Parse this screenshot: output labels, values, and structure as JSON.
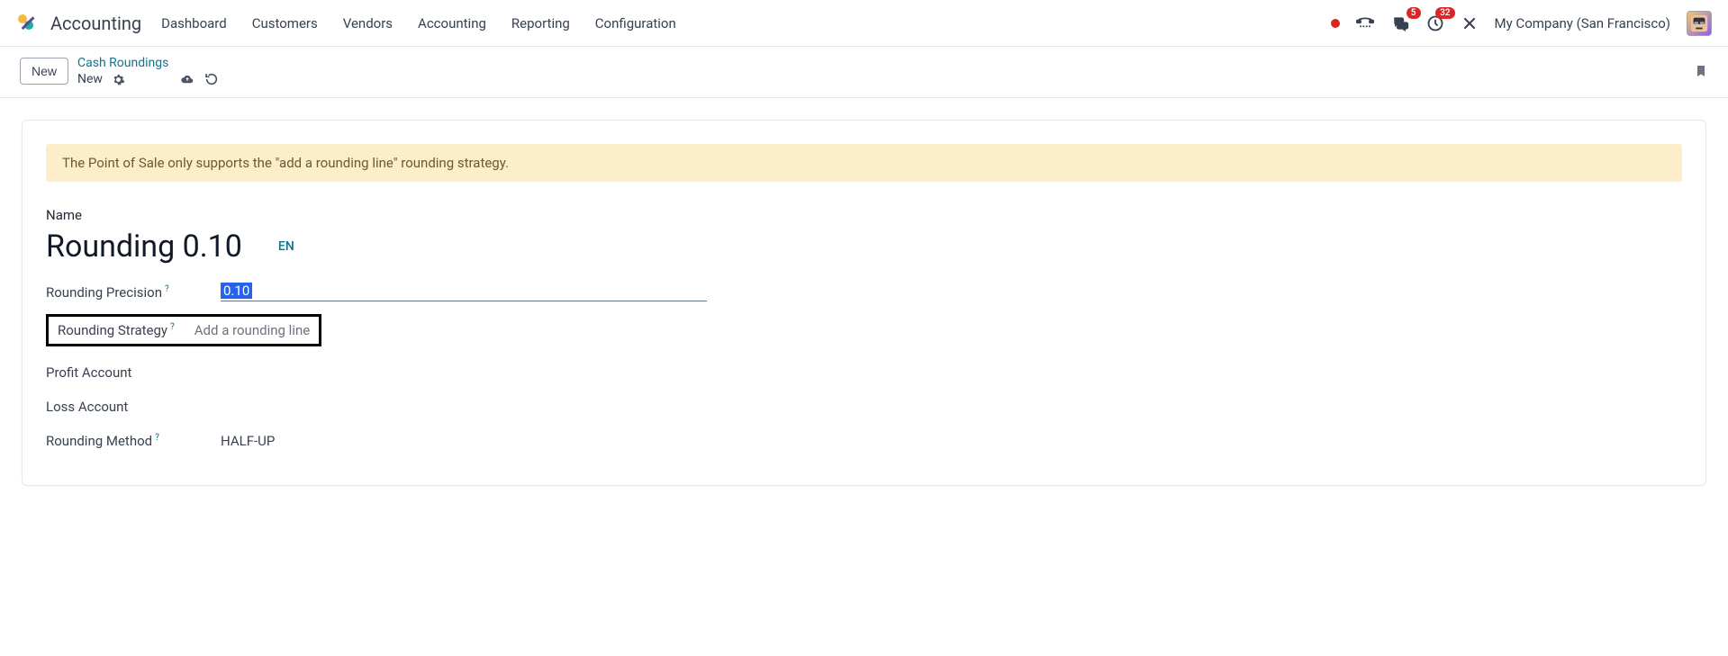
{
  "topbar": {
    "brand": "Accounting",
    "nav": [
      "Dashboard",
      "Customers",
      "Vendors",
      "Accounting",
      "Reporting",
      "Configuration"
    ],
    "badges": {
      "messages": "5",
      "activities": "32"
    },
    "company": "My Company (San Francisco)"
  },
  "subbar": {
    "new_btn": "New",
    "breadcrumb_parent": "Cash Roundings",
    "breadcrumb_current": "New"
  },
  "form": {
    "alert": "The Point of Sale only supports the \"add a rounding line\" rounding strategy.",
    "name_label": "Name",
    "name_value": "Rounding 0.10",
    "lang_badge": "EN",
    "precision_label": "Rounding Precision",
    "precision_value": "0.10",
    "strategy_label": "Rounding Strategy",
    "strategy_value": "Add a rounding line",
    "profit_label": "Profit Account",
    "loss_label": "Loss Account",
    "method_label": "Rounding Method",
    "method_value": "HALF-UP",
    "help": "?"
  }
}
